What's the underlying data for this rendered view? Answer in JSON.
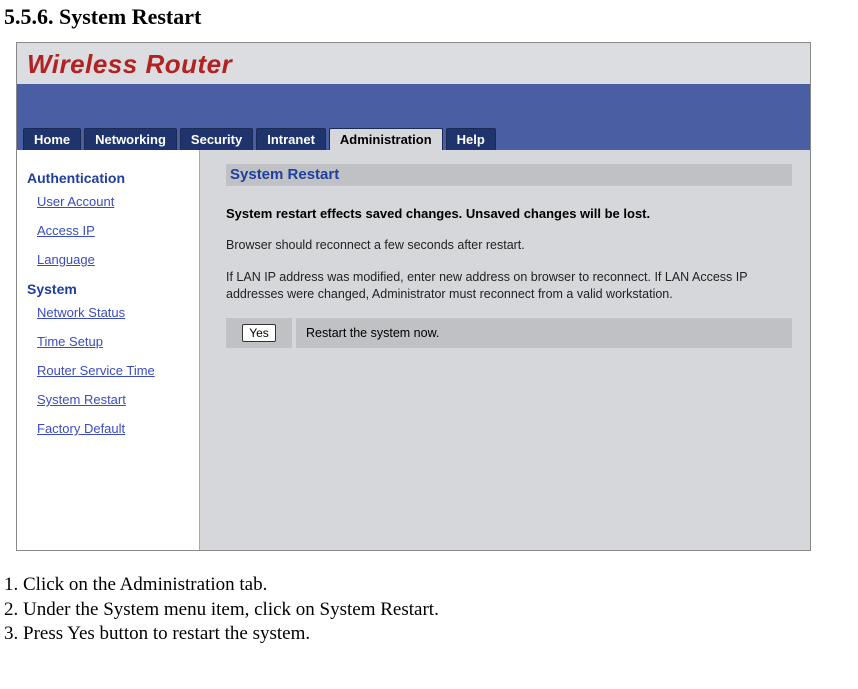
{
  "doc": {
    "heading": "5.5.6. System Restart",
    "steps": [
      "1. Click on the Administration tab.",
      "2. Under the System menu item, click on System Restart.",
      "3. Press Yes button to restart the system."
    ]
  },
  "router": {
    "logo": "Wireless Router",
    "tabs": {
      "home": "Home",
      "networking": "Networking",
      "security": "Security",
      "intranet": "Intranet",
      "administration": "Administration",
      "help": "Help"
    },
    "sidebar": {
      "section_auth": "Authentication",
      "auth_items": {
        "user_account": "User Account",
        "access_ip": "Access IP",
        "language": "Language"
      },
      "section_system": "System",
      "system_items": {
        "network_status": "Network Status",
        "time_setup": "Time Setup",
        "router_service_time": "Router Service Time",
        "system_restart": "System Restart",
        "factory_default": "Factory Default"
      }
    },
    "panel": {
      "title": "System Restart",
      "warn": "System restart effects saved changes. Unsaved changes will be lost.",
      "p1": "Browser should reconnect a few seconds after restart.",
      "p2": "If LAN IP address was modified, enter new address on browser to reconnect. If LAN Access IP addresses were changed, Administrator must reconnect from a valid workstation.",
      "yes_label": "Yes",
      "action_text": "Restart the system now."
    }
  }
}
